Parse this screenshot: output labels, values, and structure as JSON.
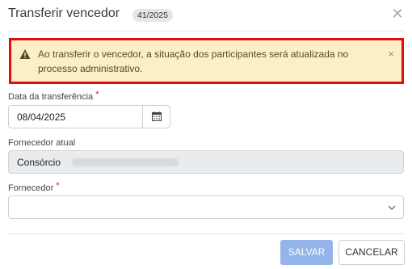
{
  "modal": {
    "title": "Transferir vencedor",
    "badge": "41/2025",
    "close_symbol": "✕"
  },
  "alert": {
    "icon": "warning-icon",
    "message": "Ao transferir o vencedor, a situação dos participantes será atualizada no processo administrativo.",
    "close_symbol": "×",
    "colors": {
      "background": "#fbefc8",
      "border": "#e30d0d"
    }
  },
  "form": {
    "date": {
      "label": "Data da transferência",
      "required_mark": "*",
      "value": "08/04/2025",
      "button_icon": "calendar-icon"
    },
    "current_supplier": {
      "label": "Fornecedor atual",
      "value": "Consórcio"
    },
    "supplier": {
      "label": "Fornecedor",
      "required_mark": "*",
      "value": "",
      "icon": "chevron-down-icon"
    }
  },
  "footer": {
    "save_label": "SALVAR",
    "cancel_label": "CANCELAR",
    "colors": {
      "save": "#95b4ea"
    }
  }
}
